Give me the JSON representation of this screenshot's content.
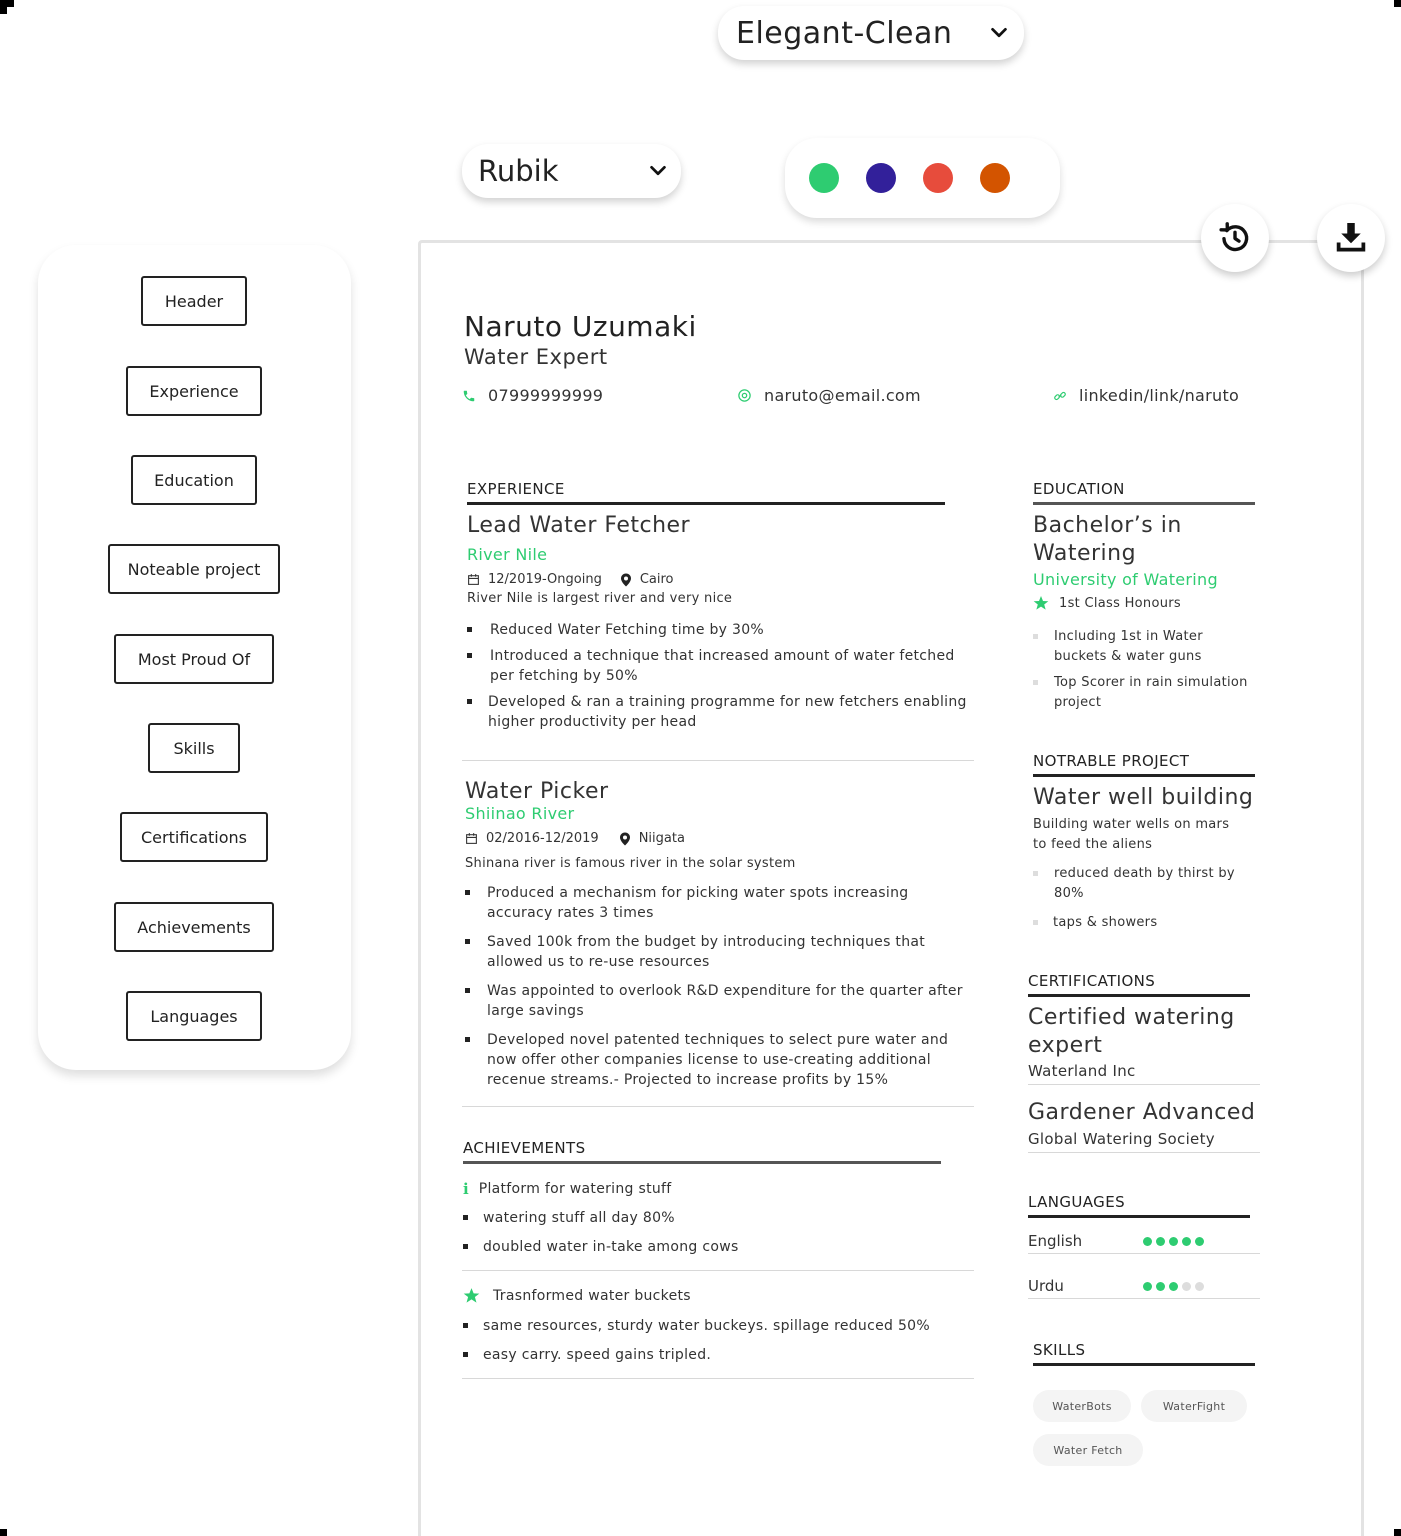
{
  "toolbar": {
    "theme": "Elegant-Clean",
    "font": "Rubik",
    "palette": [
      "#2ecc71",
      "#32209a",
      "#e74c3c",
      "#d35400"
    ]
  },
  "sections": [
    "Header",
    "Experience",
    "Education",
    "Noteable project",
    "Most Proud Of",
    "Skills",
    "Certifications",
    "Achievements",
    "Languages"
  ],
  "resume": {
    "name": "Naruto Uzumaki",
    "title": "Water Expert",
    "phone": "07999999999",
    "email": "naruto@email.com",
    "linkedin": "linkedin/link/naruto",
    "experience": {
      "heading": "EXPERIENCE",
      "jobs": [
        {
          "title": "Lead Water Fetcher",
          "company": "River Nile",
          "dates": "12/2019-Ongoing",
          "location": "Cairo",
          "summary": "River Nile is largest river and very nice",
          "bullets": [
            "Reduced Water Fetching time by 30%",
            "Introduced a technique that increased amount of water fetched per fetching by 50%",
            "Developed & ran a training programme for new fetchers enabling higher productivity per head"
          ]
        },
        {
          "title": "Water Picker",
          "company": "Shiinao River",
          "dates": "02/2016-12/2019",
          "location": "Niigata",
          "summary": "Shinana river is famous river in the solar system",
          "bullets": [
            "Produced a mechanism for picking water spots increasing accuracy rates 3 times",
            "Saved 100k from the budget by introducing techniques that allowed us to re-use resources",
            "Was appointed to overlook R&D expenditure for the quarter after large savings",
            "Developed novel patented techniques to select pure water and now offer other companies license to use-creating additional recenue streams.- Projected to increase profits by 15%"
          ]
        }
      ]
    },
    "achievements": {
      "heading": "ACHIEVEMENTS",
      "items": [
        {
          "icon": "info-icon",
          "title": "Platform for watering stuff",
          "bullets": [
            "watering stuff all day 80%",
            "doubled water in-take among cows"
          ]
        },
        {
          "icon": "star-icon",
          "title": "Trasnformed water buckets",
          "bullets": [
            "same resources, sturdy water buckeys. spillage reduced 50%",
            "easy carry. speed gains tripled."
          ]
        }
      ]
    },
    "education": {
      "heading": "EDUCATION",
      "degree_line1": "Bachelor’s in",
      "degree_line2": "Watering",
      "school": "University of Watering",
      "honours": "1st Class Honours",
      "bullets": [
        "Including 1st in Water buckets & water guns",
        "Top Scorer in rain simulation project"
      ]
    },
    "project": {
      "heading": "NOTRABLE PROJECT",
      "title": "Water well building",
      "description": "Building water wells on mars to feed the aliens",
      "bullets": [
        "reduced death by thirst by 80%",
        "taps & showers"
      ]
    },
    "certifications": {
      "heading": "CERTIFICATIONS",
      "items": [
        {
          "title_line1": "Certified watering",
          "title_line2": "expert",
          "issuer": "Waterland Inc"
        },
        {
          "title_line1": "Gardener Advanced",
          "title_line2": "",
          "issuer": "Global Watering Society"
        }
      ]
    },
    "languages": {
      "heading": "LANGUAGES",
      "items": [
        {
          "name": "English",
          "level": 5,
          "max": 5
        },
        {
          "name": "Urdu",
          "level": 3,
          "max": 5
        }
      ]
    },
    "skills": {
      "heading": "SKILLS",
      "items": [
        "WaterBots",
        "WaterFight",
        "Water Fetch"
      ]
    }
  }
}
